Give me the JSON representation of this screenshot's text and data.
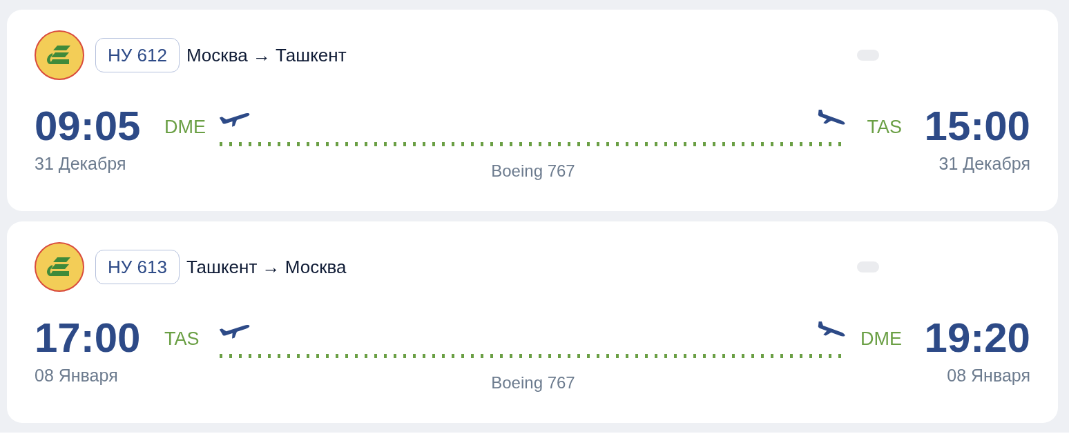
{
  "flights": [
    {
      "flight_number": "НУ 612",
      "route": "Москва → Ташкент",
      "departure": {
        "time": "09:05",
        "date": "31 Декабря",
        "airport": "DME"
      },
      "arrival": {
        "time": "15:00",
        "date": "31 Декабря",
        "airport": "TAS"
      },
      "aircraft": "Boeing 767"
    },
    {
      "flight_number": "НУ 613",
      "route": "Ташкент → Москва",
      "departure": {
        "time": "17:00",
        "date": "08 Января",
        "airport": "TAS"
      },
      "arrival": {
        "time": "19:20",
        "date": "08 Января",
        "airport": "DME"
      },
      "aircraft": "Boeing 767"
    }
  ]
}
